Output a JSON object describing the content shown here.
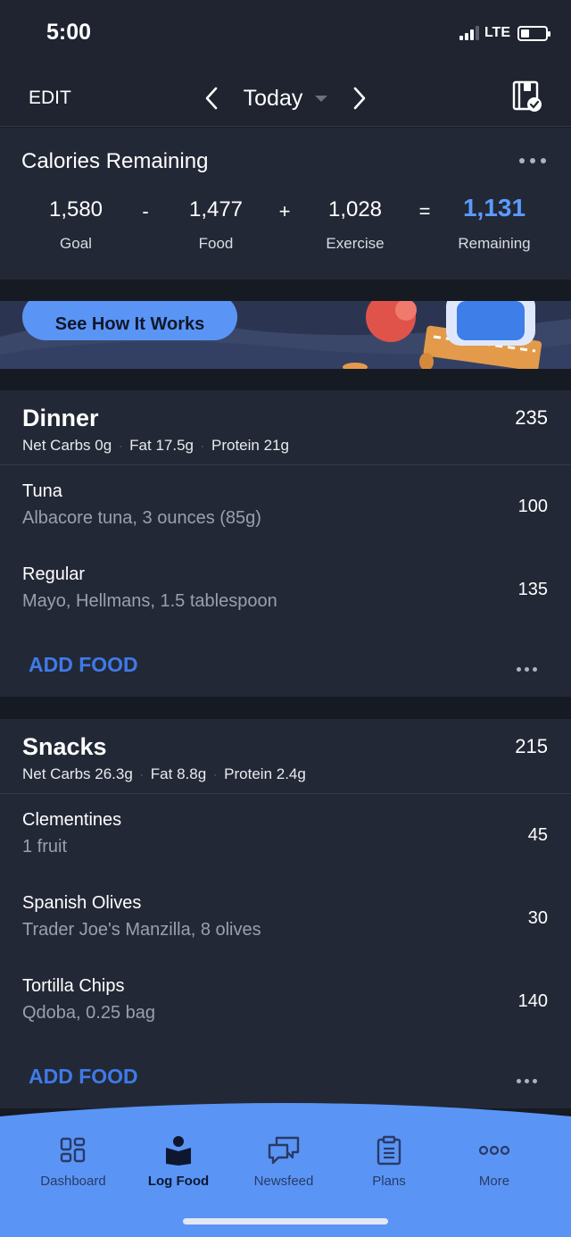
{
  "status": {
    "time": "5:00",
    "network": "LTE"
  },
  "topnav": {
    "edit": "EDIT",
    "date": "Today"
  },
  "calories": {
    "title": "Calories Remaining",
    "goal": {
      "value": "1,580",
      "label": "Goal"
    },
    "food": {
      "value": "1,477",
      "label": "Food"
    },
    "exercise": {
      "value": "1,028",
      "label": "Exercise"
    },
    "remaining": {
      "value": "1,131",
      "label": "Remaining"
    },
    "ops": {
      "minus": "-",
      "plus": "+",
      "equals": "="
    }
  },
  "banner": {
    "button": "See How It Works"
  },
  "dinner": {
    "name": "Dinner",
    "calories": "235",
    "macros": {
      "carbs": "Net Carbs 0g",
      "fat": "Fat 17.5g",
      "protein": "Protein 21g"
    },
    "items": [
      {
        "name": "Tuna",
        "desc": "Albacore  tuna, 3 ounces (85g)",
        "cal": "100"
      },
      {
        "name": "Regular",
        "desc": "Mayo, Hellmans, 1.5 tablespoon",
        "cal": "135"
      }
    ],
    "add": "ADD FOOD"
  },
  "snacks": {
    "name": "Snacks",
    "calories": "215",
    "macros": {
      "carbs": "Net Carbs 26.3g",
      "fat": "Fat 8.8g",
      "protein": "Protein 2.4g"
    },
    "items": [
      {
        "name": "Clementines",
        "desc": "1 fruit",
        "cal": "45"
      },
      {
        "name": "Spanish Olives",
        "desc": "Trader Joe's Manzilla, 8 olives",
        "cal": "30"
      },
      {
        "name": "Tortilla Chips",
        "desc": "Qdoba, 0.25 bag",
        "cal": "140"
      }
    ],
    "add": "ADD FOOD"
  },
  "tabs": [
    {
      "label": "Dashboard",
      "icon": "dashboard-grid-icon"
    },
    {
      "label": "Log Food",
      "icon": "log-food-book-icon",
      "active": true
    },
    {
      "label": "Newsfeed",
      "icon": "chat-bubbles-icon"
    },
    {
      "label": "Plans",
      "icon": "clipboard-icon"
    },
    {
      "label": "More",
      "icon": "more-dots-icon"
    }
  ],
  "colors": {
    "accent": "#5b9bff",
    "add_food": "#3f7ae8",
    "tabbar": "#5a95f5",
    "card": "#232836",
    "background": "#161a23"
  }
}
